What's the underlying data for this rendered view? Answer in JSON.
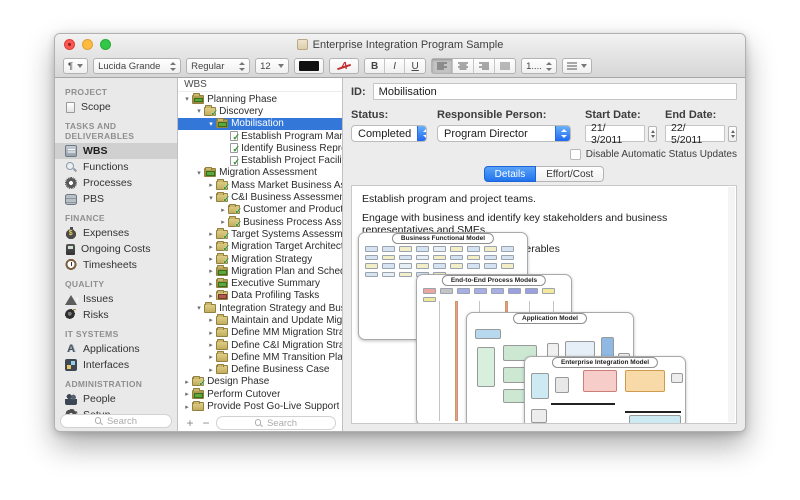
{
  "window": {
    "title": "Enterprise Integration Program Sample"
  },
  "toolbar": {
    "paragraph": "¶",
    "font_name": "Lucida Grande",
    "font_style": "Regular",
    "font_size": "12",
    "bold": "B",
    "italic": "I",
    "underline": "U",
    "spacing": "1....",
    "text_color_glyph": "A",
    "colors": {
      "text_swatch": "#111111",
      "accent_red": "#c23030"
    }
  },
  "sidebar": {
    "search_placeholder": "Search",
    "sections": [
      {
        "header": "PROJECT",
        "items": [
          {
            "label": "Scope",
            "icon": "document-icon"
          }
        ]
      },
      {
        "header": "TASKS AND DELIVERABLES",
        "items": [
          {
            "label": "WBS",
            "icon": "clipboard-icon",
            "selected": true
          },
          {
            "label": "Functions",
            "icon": "magnifier-icon"
          },
          {
            "label": "Processes",
            "icon": "gear-icon"
          },
          {
            "label": "PBS",
            "icon": "stack-icon"
          }
        ]
      },
      {
        "header": "FINANCE",
        "items": [
          {
            "label": "Expenses",
            "icon": "moneybag-icon"
          },
          {
            "label": "Ongoing Costs",
            "icon": "pump-icon"
          },
          {
            "label": "Timesheets",
            "icon": "timesheet-icon"
          }
        ]
      },
      {
        "header": "QUALITY",
        "items": [
          {
            "label": "Issues",
            "icon": "warning-icon"
          },
          {
            "label": "Risks",
            "icon": "risk-icon"
          }
        ]
      },
      {
        "header": "IT SYSTEMS",
        "items": [
          {
            "label": "Applications",
            "icon": "apps-icon"
          },
          {
            "label": "Interfaces",
            "icon": "interfaces-icon"
          }
        ]
      },
      {
        "header": "ADMINISTRATION",
        "items": [
          {
            "label": "People",
            "icon": "people-icon"
          },
          {
            "label": "Setup",
            "icon": "setup-gear-icon"
          }
        ]
      }
    ]
  },
  "tree": {
    "header": "WBS",
    "search_placeholder": "Search",
    "add_label": "+",
    "remove_label": "−",
    "selection_color": "#3377d9",
    "rows": [
      {
        "label": "Planning Phase",
        "level": 0,
        "disclosure": "open",
        "icon": "folder-progress-icon"
      },
      {
        "label": "Discovery",
        "level": 1,
        "disclosure": "open",
        "icon": "folder-check-icon"
      },
      {
        "label": "Mobilisation",
        "level": 2,
        "disclosure": "open",
        "icon": "folder-progress-icon",
        "selected": true
      },
      {
        "label": "Establish Program Manag…",
        "level": 3,
        "disclosure": "none",
        "icon": "task-check-icon"
      },
      {
        "label": "Identify Business Represe…",
        "level": 3,
        "disclosure": "none",
        "icon": "task-check-icon"
      },
      {
        "label": "Establish Project Facilities",
        "level": 3,
        "disclosure": "none",
        "icon": "task-check-icon"
      },
      {
        "label": "Migration Assessment",
        "level": 1,
        "disclosure": "open",
        "icon": "folder-progress-icon"
      },
      {
        "label": "Mass Market Business As…",
        "level": 2,
        "disclosure": "closed",
        "icon": "folder-check-icon"
      },
      {
        "label": "C&I Business Assessment",
        "level": 2,
        "disclosure": "open",
        "icon": "folder-check-icon"
      },
      {
        "label": "Customer and Product…",
        "level": 3,
        "disclosure": "closed",
        "icon": "folder-check-icon"
      },
      {
        "label": "Business Process Asse…",
        "level": 3,
        "disclosure": "closed",
        "icon": "folder-check-icon"
      },
      {
        "label": "Target Systems Assessment",
        "level": 2,
        "disclosure": "closed",
        "icon": "folder-check-icon"
      },
      {
        "label": "Migration Target Architecture",
        "level": 2,
        "disclosure": "closed",
        "icon": "folder-check-icon"
      },
      {
        "label": "Migration Strategy",
        "level": 2,
        "disclosure": "closed",
        "icon": "folder-check-icon"
      },
      {
        "label": "Migration Plan and Schedule",
        "level": 2,
        "disclosure": "closed",
        "icon": "folder-progress-icon"
      },
      {
        "label": "Executive Summary",
        "level": 2,
        "disclosure": "closed",
        "icon": "folder-progress-icon"
      },
      {
        "label": "Data Profiling Tasks",
        "level": 2,
        "disclosure": "closed",
        "icon": "folder-red-icon"
      },
      {
        "label": "Integration Strategy and Busine…",
        "level": 1,
        "disclosure": "open",
        "icon": "folder-plain-icon"
      },
      {
        "label": "Maintain and Update Migrati…",
        "level": 2,
        "disclosure": "closed",
        "icon": "folder-plain-icon"
      },
      {
        "label": "Define MM Migration Strateg…",
        "level": 2,
        "disclosure": "closed",
        "icon": "folder-plain-icon"
      },
      {
        "label": "Define C&I Migration Strateg…",
        "level": 2,
        "disclosure": "closed",
        "icon": "folder-plain-icon"
      },
      {
        "label": "Define MM Transition Plans a…",
        "level": 2,
        "disclosure": "closed",
        "icon": "folder-plain-icon"
      },
      {
        "label": "Define Business Case",
        "level": 2,
        "disclosure": "closed",
        "icon": "folder-plain-icon"
      },
      {
        "label": "Design Phase",
        "level": 0,
        "disclosure": "closed",
        "icon": "folder-check-icon"
      },
      {
        "label": "Perform Cutover",
        "level": 0,
        "disclosure": "closed",
        "icon": "folder-progress-icon"
      },
      {
        "label": "Provide Post Go-Live Support",
        "level": 0,
        "disclosure": "closed",
        "icon": "folder-plain-icon"
      }
    ]
  },
  "inspector": {
    "id_label": "ID:",
    "id_value": "Mobilisation",
    "status_label": "Status:",
    "status_value": "Completed",
    "responsible_label": "Responsible Person:",
    "responsible_value": "Program Director",
    "start_label": "Start Date:",
    "start_value": "21/ 3/2011",
    "end_label": "End Date:",
    "end_value": "22/ 5/2011",
    "checkbox_label": "Disable Automatic Status Updates",
    "checkbox_checked": false,
    "tabs": [
      "Details",
      "Effort/Cost"
    ],
    "active_tab": "Details",
    "notes": [
      "Establish program and project teams.",
      "Engage with business and identify key stakeholders and business representatives and SMEs.",
      "Identify and communicate key deliverables"
    ],
    "models": [
      "Business Functional Model",
      "End-to-End Process Models",
      "Application Model",
      "Enterprise Integration Model"
    ]
  }
}
